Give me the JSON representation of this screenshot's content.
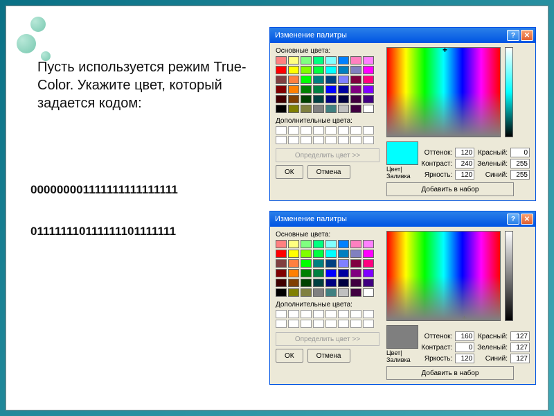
{
  "question_text": "Пусть используется режим True-Color. Укажите цвет, который задается кодом:",
  "binary1": "000000001111111111111111",
  "binary2": "011111110111111101111111",
  "dialog": {
    "title": "Изменение палитры",
    "basic_colors_label": "Основные цвета:",
    "custom_colors_label": "Дополнительные цвета:",
    "define_button": "Определить цвет >>",
    "ok": "ОК",
    "cancel": "Отмена",
    "preview_label": "Цвет|Заливка",
    "hue_label": "Оттенок:",
    "sat_label": "Контраст:",
    "lum_label": "Яркость:",
    "red_label": "Красный:",
    "green_label": "Зеленый:",
    "blue_label": "Синий:",
    "add_button": "Добавить в набор"
  },
  "d1": {
    "hue": "120",
    "sat": "240",
    "lum": "120",
    "r": "0",
    "g": "255",
    "b": "255"
  },
  "d2": {
    "hue": "160",
    "sat": "0",
    "lum": "120",
    "r": "127",
    "g": "127",
    "b": "127"
  },
  "basic_colors": [
    "#ff8080",
    "#ffff80",
    "#80ff80",
    "#00ff80",
    "#80ffff",
    "#0080ff",
    "#ff80c0",
    "#ff80ff",
    "#ff0000",
    "#ffff00",
    "#80ff00",
    "#00ff40",
    "#00ffff",
    "#0080c0",
    "#8080c0",
    "#ff00ff",
    "#804040",
    "#ff8040",
    "#00ff00",
    "#008080",
    "#004080",
    "#8080ff",
    "#800040",
    "#ff0080",
    "#800000",
    "#ff8000",
    "#008000",
    "#008040",
    "#0000ff",
    "#0000a0",
    "#800080",
    "#8000ff",
    "#400000",
    "#804000",
    "#004000",
    "#004040",
    "#000080",
    "#000040",
    "#400040",
    "#400080",
    "#000000",
    "#808000",
    "#808040",
    "#808080",
    "#408080",
    "#c0c0c0",
    "#400040",
    "#ffffff"
  ]
}
